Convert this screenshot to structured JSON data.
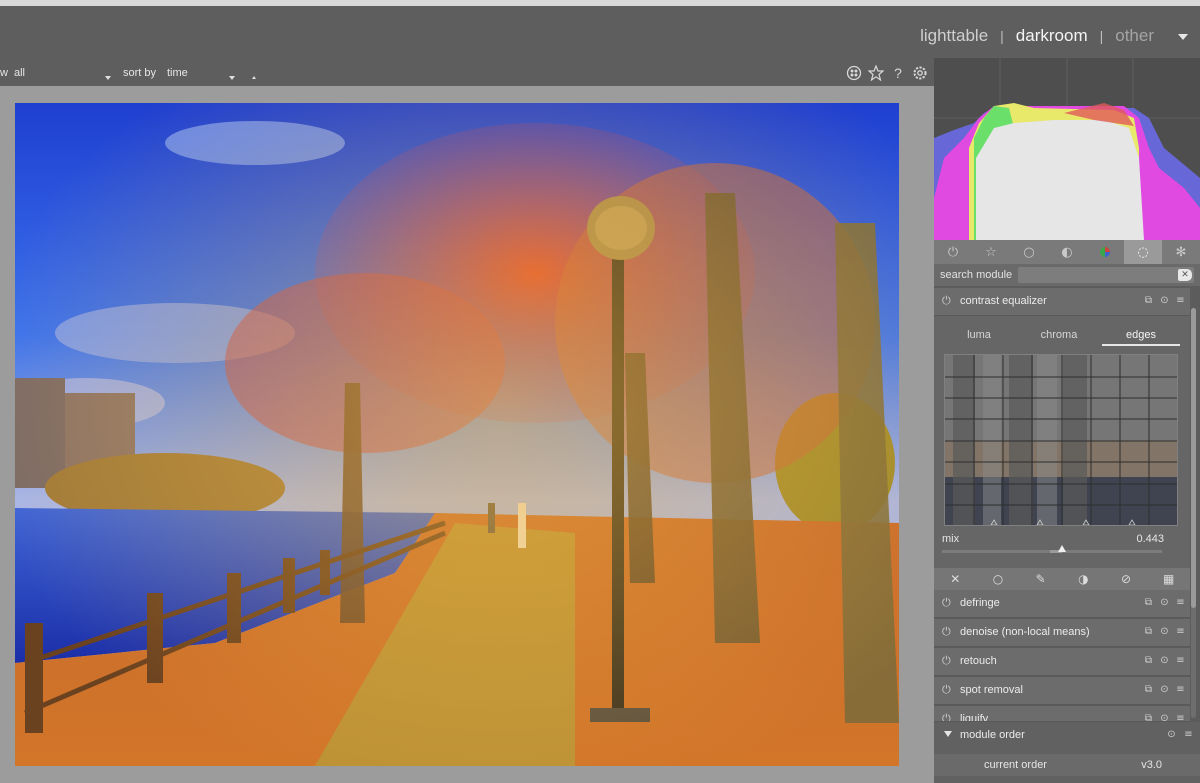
{
  "header": {
    "views": [
      {
        "label": "lighttable",
        "state": "normal"
      },
      {
        "label": "darkroom",
        "state": "active"
      },
      {
        "label": "other",
        "state": "dim"
      }
    ],
    "separator": "|"
  },
  "filterbar": {
    "view_prefix": "w",
    "filter_value": "all",
    "sort_label": "sort by",
    "sort_value": "time"
  },
  "header_icons": [
    "grouping-icon",
    "star-icon",
    "help-icon",
    "gear-icon"
  ],
  "module_groups": [
    {
      "icon": "power-icon",
      "glyph": "⏻",
      "active": false
    },
    {
      "icon": "star-outline-icon",
      "glyph": "☆",
      "active": false
    },
    {
      "icon": "circle-icon",
      "glyph": "○",
      "active": false
    },
    {
      "icon": "tone-sphere-icon",
      "glyph": "◐",
      "active": false
    },
    {
      "icon": "color-sphere-icon",
      "glyph": "●",
      "active": false
    },
    {
      "icon": "correct-icon",
      "glyph": "◌",
      "active": true
    },
    {
      "icon": "effect-icon",
      "glyph": "✻",
      "active": false
    }
  ],
  "search": {
    "label": "search module",
    "placeholder": "",
    "value": ""
  },
  "contrast_equalizer": {
    "name": "contrast equalizer",
    "tabs": [
      "luma",
      "chroma",
      "edges"
    ],
    "active_tab": "edges",
    "mix_label": "mix",
    "mix_value": "0.443",
    "mix_fraction": 0.443
  },
  "blend_modes": [
    {
      "icon": "blend-off-icon",
      "glyph": "✕"
    },
    {
      "icon": "blend-uniform-icon",
      "glyph": "○"
    },
    {
      "icon": "blend-drawn-icon",
      "glyph": "✎"
    },
    {
      "icon": "blend-parametric-icon",
      "glyph": "◑"
    },
    {
      "icon": "blend-drawn-parametric-icon",
      "glyph": "⊘"
    },
    {
      "icon": "blend-raster-icon",
      "glyph": "▦"
    }
  ],
  "modules": [
    {
      "name": "defringe"
    },
    {
      "name": "denoise (non-local means)"
    },
    {
      "name": "retouch"
    },
    {
      "name": "spot removal"
    },
    {
      "name": "liquify"
    }
  ],
  "module_order": {
    "title": "module order",
    "label": "current order",
    "value": "v3.0"
  },
  "colors": {
    "panel": "#5c5c5c",
    "header": "#5e5e5e",
    "canvas_border": "#9c9c9c"
  }
}
